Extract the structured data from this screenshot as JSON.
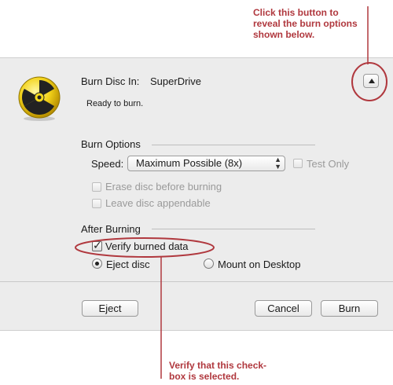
{
  "annotations": {
    "top_lines": [
      "Click this button to",
      "reveal the burn options",
      "shown below."
    ],
    "bottom_lines": [
      "Verify that this check-",
      "box is selected."
    ]
  },
  "dialog": {
    "burn_disc_label": "Burn Disc In:",
    "drive_name": "SuperDrive",
    "status": "Ready to burn.",
    "icon": "burn-disc-icon",
    "disclosure_icon": "triangle-up-icon"
  },
  "burn_options": {
    "heading": "Burn Options",
    "speed_label": "Speed:",
    "speed_value": "Maximum Possible (8x)",
    "test_only_label": "Test Only",
    "erase_label": "Erase disc before burning",
    "leave_appendable_label": "Leave disc appendable"
  },
  "after_burning": {
    "heading": "After Burning",
    "verify_label": "Verify burned data",
    "verify_checked": true,
    "eject_label": "Eject disc",
    "mount_label": "Mount on Desktop",
    "selected_action": "Eject disc"
  },
  "buttons": {
    "eject": "Eject",
    "cancel": "Cancel",
    "burn": "Burn"
  },
  "colors": {
    "annotation": "#b0383e",
    "dialog_background": "#ececec"
  }
}
